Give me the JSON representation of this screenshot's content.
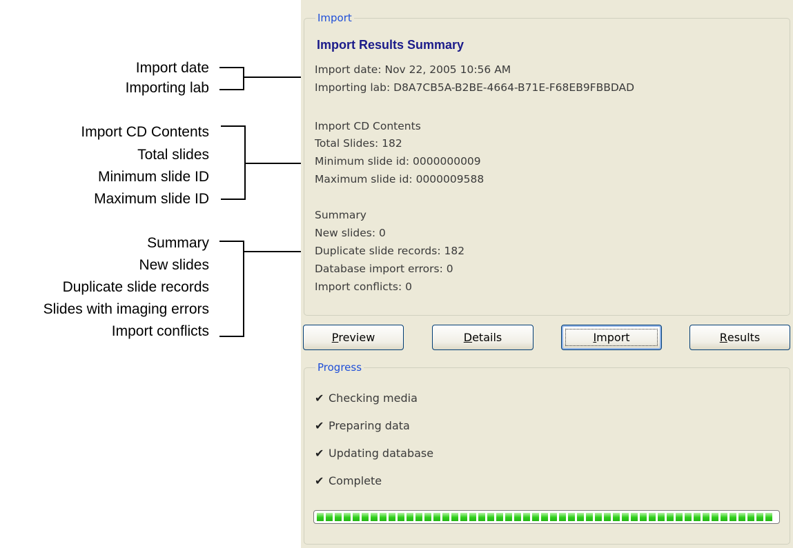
{
  "annotations": {
    "group1": [
      "Import date",
      "Importing lab"
    ],
    "group2": [
      "Import CD Contents",
      "Total slides",
      "Minimum slide ID",
      "Maximum slide ID"
    ],
    "group3": [
      "Summary",
      "New slides",
      "Duplicate slide records",
      "Slides with imaging errors",
      "Import conflicts"
    ]
  },
  "import_group": {
    "legend": "Import",
    "heading": "Import Results Summary",
    "import_date": "Import date: Nov 22, 2005 10:56 AM",
    "importing_lab": "Importing lab: D8A7CB5A-B2BE-4664-B71E-F68EB9FBBDAD",
    "cd_contents_title": "Import CD Contents",
    "total_slides": "Total Slides: 182",
    "min_slide": "Minimum slide id: 0000000009",
    "max_slide": "Maximum slide id: 0000009588",
    "summary_title": "Summary",
    "new_slides": "New slides: 0",
    "duplicate_records": "Duplicate slide records: 182",
    "db_errors": "Database import errors: 0",
    "conflicts": "Import conflicts: 0"
  },
  "buttons": {
    "preview": {
      "accel": "P",
      "rest": "review"
    },
    "details": {
      "accel": "D",
      "rest": "etails"
    },
    "import": {
      "accel": "I",
      "rest": "mport"
    },
    "results": {
      "accel": "R",
      "rest": "esults"
    }
  },
  "progress_group": {
    "legend": "Progress",
    "steps": [
      "Checking media",
      "Preparing data",
      "Updating database",
      "Complete"
    ],
    "check_glyph": "✔",
    "percent_complete": 100
  },
  "colors": {
    "legend": "#1f4fd8",
    "heading": "#1b1b8a",
    "progress": "#2fcf1b",
    "panel": "#ece9d8"
  }
}
